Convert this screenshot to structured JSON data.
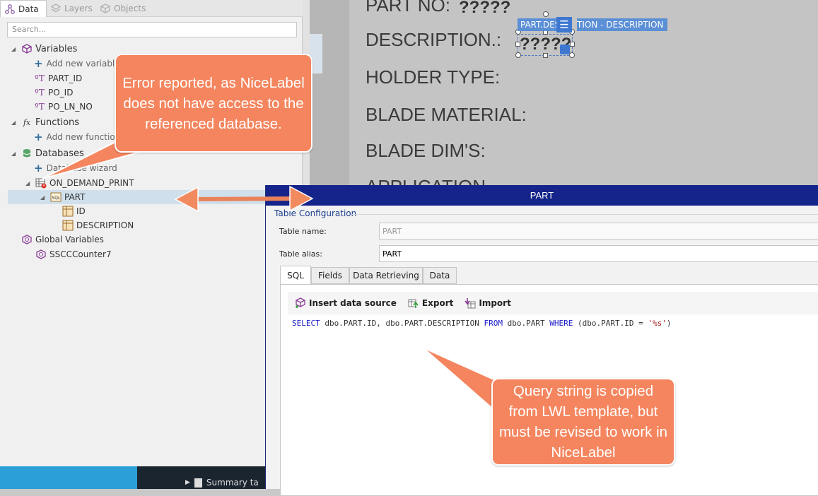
{
  "panel": {
    "tabs": [
      {
        "label": "Data",
        "icon": "data-icon"
      },
      {
        "label": "Layers",
        "icon": "layers-icon"
      },
      {
        "label": "Objects",
        "icon": "objects-icon"
      }
    ],
    "search_placeholder": "Search..."
  },
  "tree": {
    "variables": "Variables",
    "add_variable": "Add new variable",
    "var_items": [
      "PART_ID",
      "PO_ID",
      "PO_LN_NO"
    ],
    "functions": "Functions",
    "add_function": "Add new function",
    "databases": "Databases",
    "db_wizard": "Database wizard",
    "db_name": "ON_DEMAND_PRINT",
    "table": "PART",
    "fields": [
      "ID",
      "DESCRIPTION"
    ],
    "global_vars": "Global Variables",
    "counter": "SSCCCounter7"
  },
  "canvas": {
    "labels": [
      "PART NO:",
      "DESCRIPTION.:",
      "HOLDER TYPE:",
      "BLADE MATERIAL:",
      "BLADE DIM'S:",
      "APPLICATION"
    ],
    "placeholder": "?????",
    "tag_left": "PART.DES",
    "tag_right": "TION - DESCRIPTION"
  },
  "dialog": {
    "title": "PART",
    "group": "Table Configuration",
    "table_name_label": "Table name:",
    "table_name_value": "PART",
    "table_alias_label": "Table alias:",
    "table_alias_value": "PART",
    "tabs": [
      "SQL",
      "Fields",
      "Data Retrieving",
      "Data"
    ],
    "toolbar": {
      "insert": "Insert data source",
      "export": "Export",
      "import": "Import"
    },
    "sql": {
      "k1": "SELECT",
      "t1": " dbo.PART.ID, dbo.PART.DESCRIPTION ",
      "k2": "FROM",
      "t2": " dbo.PART ",
      "k3": "WHERE",
      "t3": " (dbo.PART.ID = ",
      "s1": "'%s'",
      "t4": ")"
    }
  },
  "taskbar": {
    "item": "Summary ta"
  },
  "callouts": {
    "error": "Error reported, as NiceLabel does not have access to the referenced database.",
    "query": "Query string is copied from LWL template, but must be revised to work in NiceLabel"
  },
  "colors": {
    "callout": "#f4855e",
    "dialog_title": "#14248a"
  }
}
